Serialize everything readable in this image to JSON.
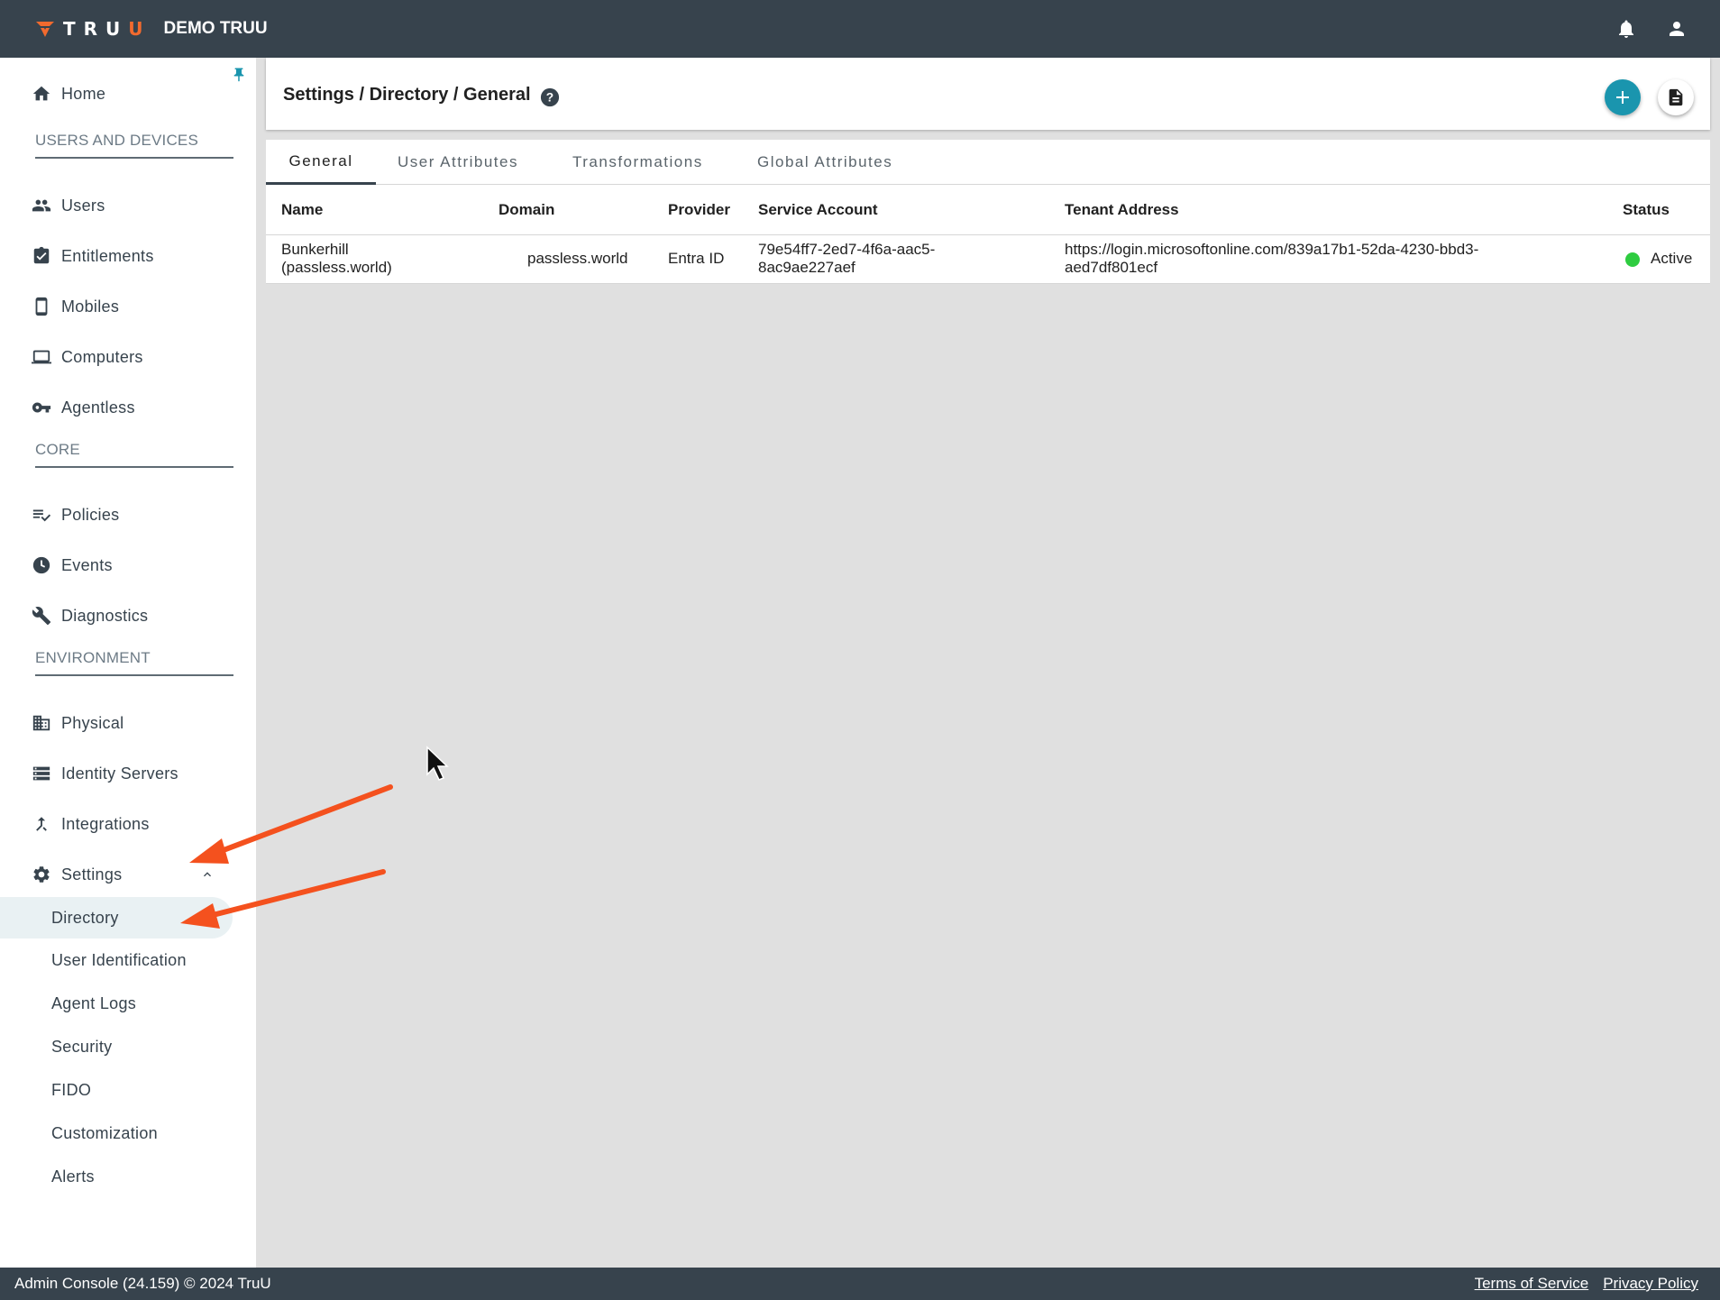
{
  "topbar": {
    "brand": "TRU",
    "brand_accent": "U",
    "tenant": "DEMO TRUU",
    "bell_icon": "bell-icon",
    "user_icon": "account-icon"
  },
  "sidebar": {
    "home": "Home",
    "sections": {
      "users_devices": "USERS AND DEVICES",
      "core": "CORE",
      "environment": "ENVIRONMENT"
    },
    "items": {
      "users": "Users",
      "entitlements": "Entitlements",
      "mobiles": "Mobiles",
      "computers": "Computers",
      "agentless": "Agentless",
      "policies": "Policies",
      "events": "Events",
      "diagnostics": "Diagnostics",
      "physical": "Physical",
      "identity_servers": "Identity Servers",
      "integrations": "Integrations",
      "settings": "Settings"
    },
    "settings_sub": {
      "directory": "Directory",
      "user_identification": "User Identification",
      "agent_logs": "Agent Logs",
      "security": "Security",
      "fido": "FIDO",
      "customization": "Customization",
      "alerts": "Alerts"
    }
  },
  "header": {
    "breadcrumb": "Settings / Directory / General"
  },
  "tabs": {
    "general": "General",
    "user_attributes": "User Attributes",
    "transformations": "Transformations",
    "global_attributes": "Global Attributes"
  },
  "table": {
    "headers": {
      "name": "Name",
      "domain": "Domain",
      "provider": "Provider",
      "service_account": "Service Account",
      "tenant_address": "Tenant Address",
      "status": "Status"
    },
    "rows": [
      {
        "name_line1": "Bunkerhill",
        "name_line2": "(passless.world)",
        "domain": "passless.world",
        "provider": "Entra ID",
        "service_account_line1": "79e54ff7-2ed7-4f6a-aac5-",
        "service_account_line2": "8ac9ae227aef",
        "tenant_line1": "https://login.microsoftonline.com/839a17b1-52da-4230-bbd3-",
        "tenant_line2": "aed7df801ecf",
        "status": "Active"
      }
    ]
  },
  "footer": {
    "copyright": "Admin Console (24.159) © 2024 TruU",
    "terms": "Terms of Service",
    "privacy": "Privacy Policy"
  },
  "colors": {
    "topbar": "#37434d",
    "accent": "#1a95ae",
    "brand_orange": "#f26a2e",
    "status_active": "#2ecc40",
    "annotation_arrow": "#f4511e"
  }
}
